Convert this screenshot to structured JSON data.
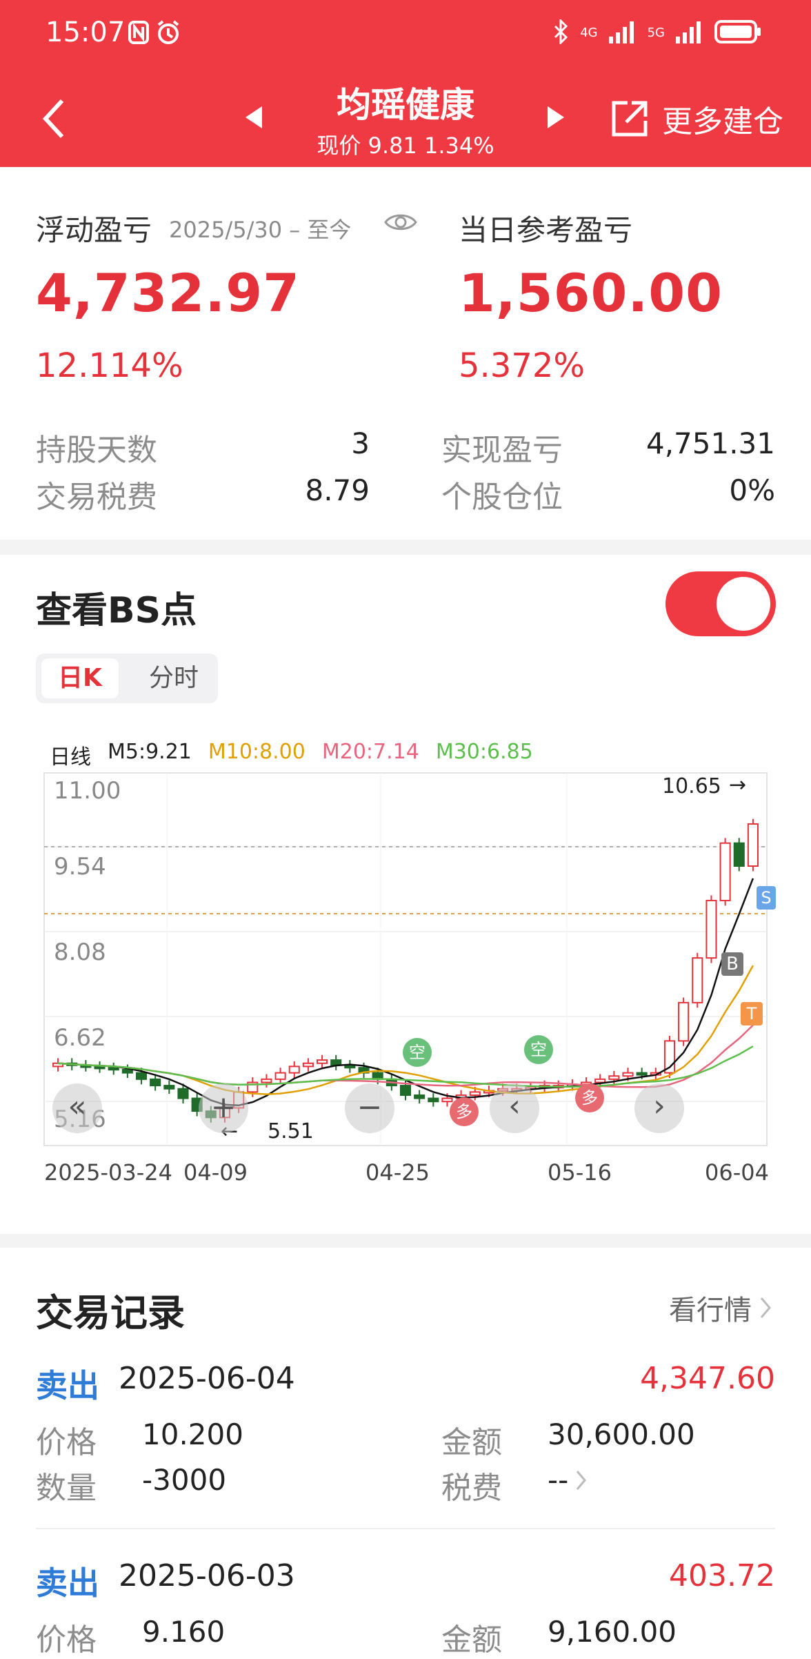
{
  "status": {
    "time": "15:07",
    "sig1": "4G",
    "sig2": "5G"
  },
  "header": {
    "title": "均瑶健康",
    "subtitle": "现价 9.81 1.34%",
    "more_label": "更多建仓"
  },
  "pnl": {
    "floating_label": "浮动盈亏",
    "floating_period": "2025/5/30 – 至今",
    "floating_value": "4,732.97",
    "floating_pct": "12.114%",
    "daily_label": "当日参考盈亏",
    "daily_value": "1,560.00",
    "daily_pct": "5.372%"
  },
  "stats": {
    "hold_days_label": "持股天数",
    "hold_days": "3",
    "tax_label": "交易税费",
    "tax": "8.79",
    "realized_label": "实现盈亏",
    "realized": "4,751.31",
    "position_label": "个股仓位",
    "position": "0%"
  },
  "bs": {
    "title": "查看BS点",
    "toggle_on": true,
    "tab_day": "日K",
    "tab_intraday": "分时"
  },
  "chart_data": {
    "type": "candlestick",
    "legend": [
      {
        "name": "日线",
        "color": "#222222"
      },
      {
        "name": "M5:9.21",
        "color": "#222222"
      },
      {
        "name": "M10:8.00",
        "color": "#e0a000"
      },
      {
        "name": "M20:7.14",
        "color": "#e8657e"
      },
      {
        "name": "M30:6.85",
        "color": "#5cbf4b"
      }
    ],
    "y_ticks": [
      "11.00",
      "9.54",
      "8.08",
      "6.62",
      "5.16"
    ],
    "y_range": [
      5.16,
      11.0
    ],
    "x_ticks": [
      "2025-03-24",
      "04-09",
      "04-25",
      "05-16",
      "06-04"
    ],
    "high_label": "10.65",
    "low_label": "5.51",
    "markers": [
      "B",
      "S",
      "T"
    ],
    "signals": [
      "空",
      "多",
      "空",
      "多"
    ]
  },
  "chart_controls": [
    "«",
    "+",
    "−",
    "‹",
    "›"
  ],
  "records": {
    "title": "交易记录",
    "link": "看行情",
    "items": [
      {
        "type": "卖出",
        "date": "2025-06-04",
        "amount": "4,347.60",
        "price_label": "价格",
        "price": "10.200",
        "qty_label": "数量",
        "qty": "-3000",
        "total_label": "金额",
        "total": "30,600.00",
        "tax_label": "税费",
        "tax": "--"
      },
      {
        "type": "卖出",
        "date": "2025-06-03",
        "amount": "403.72",
        "price_label": "价格",
        "price": "9.160",
        "total_label": "金额",
        "total": "9,160.00"
      }
    ]
  }
}
